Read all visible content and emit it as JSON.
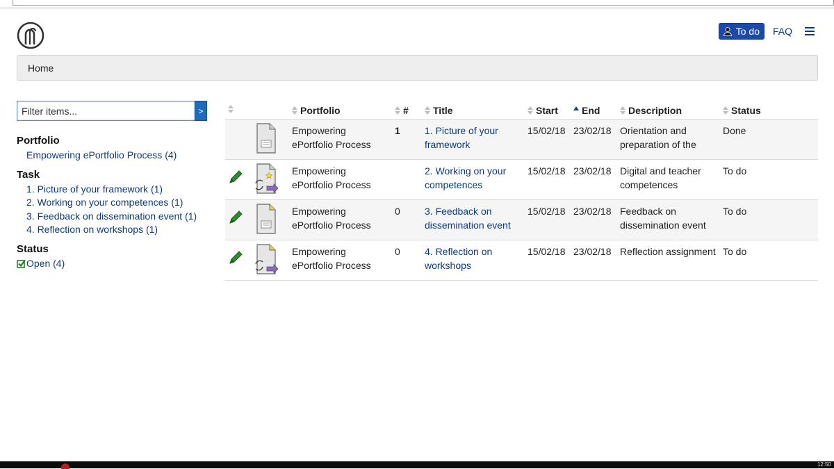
{
  "header": {
    "todo_label": "To do",
    "faq_label": "FAQ"
  },
  "breadcrumb": {
    "home": "Home"
  },
  "filter": {
    "placeholder": "Filter items...",
    "button": ">"
  },
  "facets": {
    "portfolio": {
      "title": "Portfolio",
      "items": [
        "Empowering ePortfolio Process (4)"
      ]
    },
    "task": {
      "title": "Task",
      "items": [
        "1. Picture of your framework (1)",
        "2. Working on your competences (1)",
        "3. Feedback on dissemination event  (1)",
        "4. Reflection on workshops (1)"
      ]
    },
    "status": {
      "title": "Status",
      "items": [
        "Open (4)"
      ]
    }
  },
  "table": {
    "columns": [
      "Portfolio",
      "#",
      "Title",
      "Start",
      "End",
      "Description",
      "Status"
    ],
    "rows": [
      {
        "portfolio": [
          "Empowering",
          "ePortfolio Process"
        ],
        "num": "1",
        "title": [
          "1. Picture of your",
          "framework"
        ],
        "start": "15/02/18",
        "end": "23/02/18",
        "description": [
          "Orientation and",
          "preparation of the"
        ],
        "status": "Done",
        "editable": false,
        "icon": "document-icon"
      },
      {
        "portfolio": [
          "Empowering",
          "ePortfolio Process"
        ],
        "num": "",
        "title": [
          "2. Working on your",
          "competences"
        ],
        "start": "15/02/18",
        "end": "23/02/18",
        "description": [
          "Digital and teacher",
          "competences"
        ],
        "status": "To do",
        "editable": true,
        "icon": "assignment-icon"
      },
      {
        "portfolio": [
          "Empowering",
          "ePortfolio Process"
        ],
        "num": "0",
        "title": [
          "3. Feedback on",
          "dissemination event"
        ],
        "start": "15/02/18",
        "end": "23/02/18",
        "description": [
          "Feedback on",
          "dissemination event"
        ],
        "status": "To do",
        "editable": true,
        "icon": "document-icon"
      },
      {
        "portfolio": [
          "Empowering",
          "ePortfolio Process"
        ],
        "num": "0",
        "title": [
          "4. Reflection on",
          "workshops"
        ],
        "start": "15/02/18",
        "end": "23/02/18",
        "description": [
          "Reflection assignment",
          ""
        ],
        "status": "To do",
        "editable": true,
        "icon": "assignment-icon"
      }
    ]
  },
  "taskbar": {
    "clock": "12:50"
  }
}
